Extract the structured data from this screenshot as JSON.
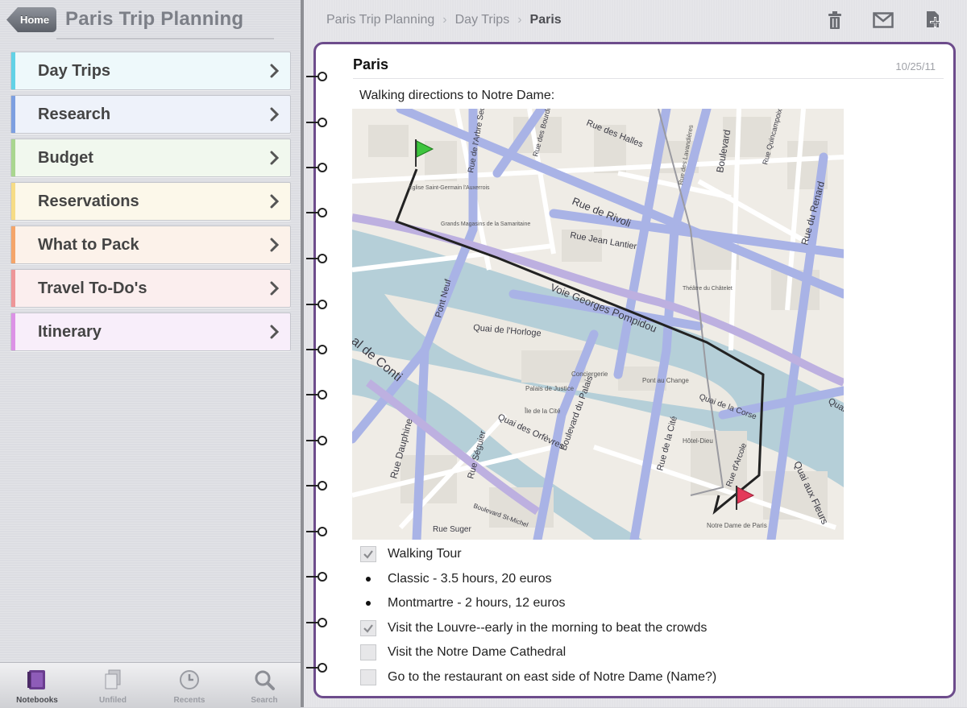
{
  "left": {
    "home_label": "Home",
    "title": "Paris Trip Planning",
    "sections": [
      {
        "label": "Day Trips",
        "color": "#62d2e6",
        "bg": "#eef9fb"
      },
      {
        "label": "Research",
        "color": "#7d9fe0",
        "bg": "#eef2fa"
      },
      {
        "label": "Budget",
        "color": "#a9d68f",
        "bg": "#f1f8ee"
      },
      {
        "label": "Reservations",
        "color": "#f6dc86",
        "bg": "#fcf8ea"
      },
      {
        "label": "What to Pack",
        "color": "#f4a56a",
        "bg": "#fcf2ea"
      },
      {
        "label": "Travel To-Do's",
        "color": "#ee9698",
        "bg": "#fbeeee"
      },
      {
        "label": "Itinerary",
        "color": "#dc92e6",
        "bg": "#f8eefa"
      }
    ],
    "toolbar": [
      {
        "label": "Notebooks",
        "icon": "notebooks-icon",
        "active": true
      },
      {
        "label": "Unfiled",
        "icon": "unfiled-icon",
        "active": false
      },
      {
        "label": "Recents",
        "icon": "recents-icon",
        "active": false
      },
      {
        "label": "Search",
        "icon": "search-icon",
        "active": false
      }
    ]
  },
  "right": {
    "breadcrumb": [
      "Paris Trip Planning",
      "Day Trips",
      "Paris"
    ],
    "actions": [
      "trash-icon",
      "mail-icon",
      "add-page-icon"
    ]
  },
  "page": {
    "title": "Paris",
    "date": "10/25/11",
    "intro": "Walking directions to Notre Dame:",
    "map": {
      "streets": {
        "rivoli": "Rue de Rivoli",
        "halles": "Rue des Halles",
        "jean_lantier": "Rue Jean Lantier",
        "renard": "Rue du Renard",
        "pompidou": "Voie Georges Pompidou",
        "horloge": "Quai de l'Horloge",
        "conti": "al de Conti",
        "pont_neuf": "Pont Neuf",
        "dauphine": "Rue Dauphine",
        "seguier": "Rue Séguier",
        "orfevres": "Quai des Orfèvres",
        "boulevard_palais": "Boulevard du Palais",
        "cite": "Rue de la Cité",
        "corse": "Quai de la Corse",
        "arcole": "Rue d'Arcole",
        "fleurs": "Quai aux Fleurs",
        "arbre_sec": "Rue de l'Arbre Sec",
        "sebastopol": "Boulevard",
        "quincampoix": "Rue Quincampoix",
        "bourdonnais": "Rue des Bourdonnais",
        "hotel_ville": "Quai de l'",
        "suger": "Rue Suger",
        "st_michel": "Boulevard St-Michel",
        "conciergerie": "Conciergerie",
        "palais_justice": "Palais de Justice",
        "ile_cite": "Île de la Cité",
        "hotel_dieu": "Hôtel-Dieu",
        "notre_dame": "Notre Dame de Paris",
        "pont_change": "Pont au Change",
        "lavandiers": "Rue des Lavandières",
        "saint_germain": "Église Saint-Germain l'Auxerrois",
        "magasins": "Grands Magasins de la Samaritaine",
        "chatelet": "Théâtre du Châtelet"
      }
    },
    "checklist": [
      {
        "type": "checkbox",
        "checked": true,
        "text": "Walking Tour"
      },
      {
        "type": "bullet",
        "text": "Classic - 3.5 hours, 20 euros"
      },
      {
        "type": "bullet",
        "text": "Montmartre - 2 hours, 12 euros"
      },
      {
        "type": "checkbox",
        "checked": true,
        "text": "Visit the Louvre--early in the morning to beat the crowds"
      },
      {
        "type": "checkbox",
        "checked": false,
        "text": "Visit the Notre Dame Cathedral"
      },
      {
        "type": "checkbox",
        "checked": false,
        "text": "Go to the restaurant on east side of Notre Dame (Name?)"
      }
    ]
  }
}
